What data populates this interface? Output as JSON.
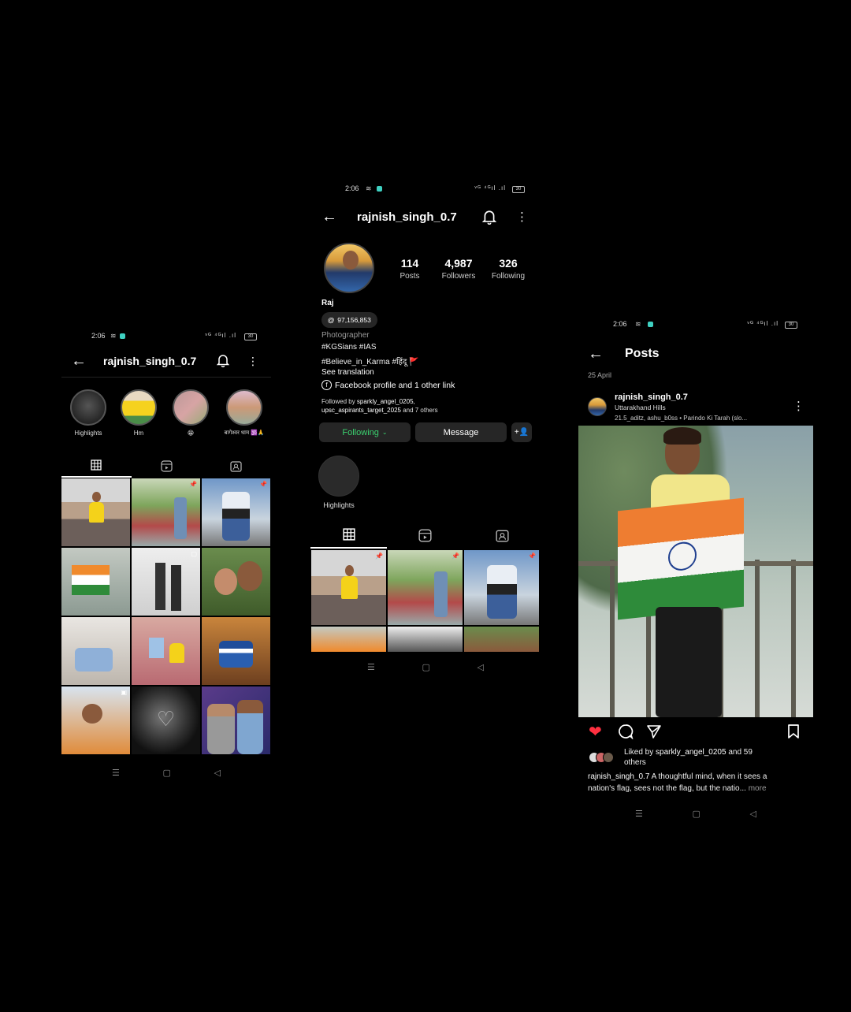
{
  "left": {
    "status": {
      "time": "2:06",
      "icons": "ᵛᴳ ⁴ᴳıl .ıl",
      "battery": "30"
    },
    "username": "rajnish_singh_0.7",
    "highlights": [
      {
        "label": "Highlights"
      },
      {
        "label": "Hm"
      },
      {
        "label": "😁"
      },
      {
        "label": "बागेश्वर धाम 🕉️🙏"
      }
    ]
  },
  "middle": {
    "status": {
      "time": "2:06",
      "icons": "ᵛᴳ ⁴ᴳıl .ıl",
      "battery": "30"
    },
    "username": "rajnish_singh_0.7",
    "stats": [
      {
        "value": "114",
        "label": "Posts"
      },
      {
        "value": "4,987",
        "label": "Followers"
      },
      {
        "value": "326",
        "label": "Following"
      }
    ],
    "name": "Raj",
    "threads_count": "97,156,853",
    "category": "Photographer",
    "bio_line1": "#KGSians  #IAS",
    "bio_line2": "#Believe_in_Karma  #हिंदू 🚩",
    "see_translation": "See translation",
    "link_text": "Facebook profile and 1 other link",
    "followed_by_prefix": "Followed by ",
    "followed_by_names1": "sparkly_angel_0205,",
    "followed_by_names2": "upsc_aspirants_target_2025",
    "followed_by_suffix": " and 7 others",
    "following_label": "Following",
    "message_label": "Message",
    "highlight_label": "Highlights"
  },
  "right": {
    "status": {
      "time": "2:06",
      "icons": "ᵛᴳ ⁴ᴳıl .ıl",
      "battery": "30"
    },
    "title": "Posts",
    "date": "25 April",
    "post_user": "rajnish_singh_0.7",
    "location": "Uttarakhand Hills",
    "audio": "21.5_aditz, ashu_b0ss • Parindo Ki Tarah (slo...",
    "liked_prefix": "Liked by ",
    "liked_name": "sparkly_angel_0205",
    "liked_suffix": " and 59",
    "liked_others": "others",
    "caption_user": "rajnish_singh_0.7",
    "caption_text": " A thoughtful mind, when it sees a",
    "caption_line2": "nation's flag, sees not the flag, but the natio...",
    "more": " more"
  },
  "colors": {
    "bg": "#000000",
    "following_green": "#3bd16f",
    "like_red": "#ff3040",
    "button_bg": "#262626"
  }
}
